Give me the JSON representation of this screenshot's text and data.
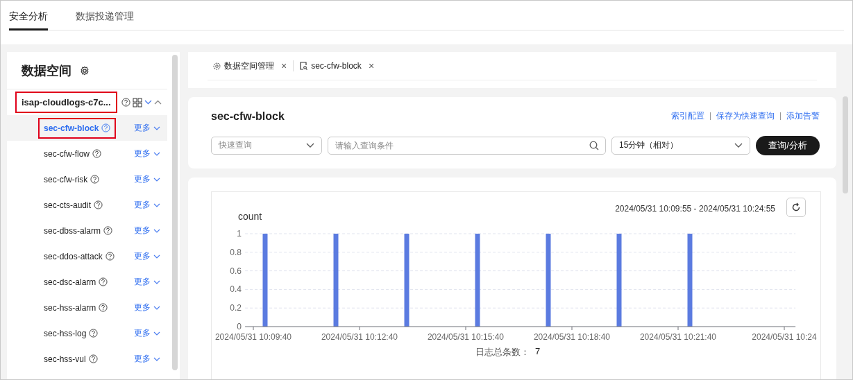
{
  "top_tabs": [
    {
      "label": "安全分析",
      "selected": true
    },
    {
      "label": "数据投递管理",
      "selected": false
    }
  ],
  "sidebar": {
    "title": "数据空间",
    "group": {
      "name": "isap-cloudlogs-c7c...",
      "highlighted": true,
      "expanded": true,
      "items": [
        {
          "name": "sec-cfw-block",
          "more": "更多",
          "selected": true,
          "highlighted": true
        },
        {
          "name": "sec-cfw-flow",
          "more": "更多",
          "selected": false,
          "highlighted": false
        },
        {
          "name": "sec-cfw-risk",
          "more": "更多",
          "selected": false,
          "highlighted": false
        },
        {
          "name": "sec-cts-audit",
          "more": "更多",
          "selected": false,
          "highlighted": false
        },
        {
          "name": "sec-dbss-alarm",
          "more": "更多",
          "selected": false,
          "highlighted": false
        },
        {
          "name": "sec-ddos-attack",
          "more": "更多",
          "selected": false,
          "highlighted": false
        },
        {
          "name": "sec-dsc-alarm",
          "more": "更多",
          "selected": false,
          "highlighted": false
        },
        {
          "name": "sec-hss-alarm",
          "more": "更多",
          "selected": false,
          "highlighted": false
        },
        {
          "name": "sec-hss-log",
          "more": "更多",
          "selected": false,
          "highlighted": false
        },
        {
          "name": "sec-hss-vul",
          "more": "更多",
          "selected": false,
          "highlighted": false
        }
      ]
    }
  },
  "open_tabs": [
    {
      "kind": "settings",
      "label": "数据空间管理",
      "close": "×"
    },
    {
      "kind": "log",
      "label": "sec-cfw-block",
      "close": "×"
    }
  ],
  "query": {
    "title": "sec-cfw-block",
    "links": [
      "索引配置",
      "保存为快速查询",
      "添加告警"
    ],
    "quick_query": {
      "placeholder": "快速查询"
    },
    "condition": {
      "placeholder": "请输入查询条件"
    },
    "time_range": "15分钟（相对）",
    "submit": "查询/分析"
  },
  "chart": {
    "range": "2024/05/31 10:09:55 - 2024/05/31 10:24:55",
    "total_label": "日志总条数：",
    "total": "7",
    "chart_data": {
      "type": "bar",
      "categories": [
        "2024/05/31 10:09:40",
        null,
        null,
        "2024/05/31 10:12:40",
        null,
        null,
        "2024/05/31 10:15:40",
        null,
        null,
        "2024/05/31 10:18:40",
        null,
        null,
        "2024/05/31 10:21:40",
        null,
        null,
        "2024/05/31 10:24"
      ],
      "series": [
        {
          "name": "count",
          "color": "#5b7be0",
          "values": [
            1,
            null,
            1,
            null,
            1,
            null,
            1,
            null,
            1,
            null,
            1,
            null,
            1,
            null,
            null,
            null
          ]
        }
      ],
      "ylim": [
        0,
        1
      ],
      "yticks": [
        0,
        0.2,
        0.4,
        0.6,
        0.8,
        1
      ],
      "grid": true
    }
  }
}
